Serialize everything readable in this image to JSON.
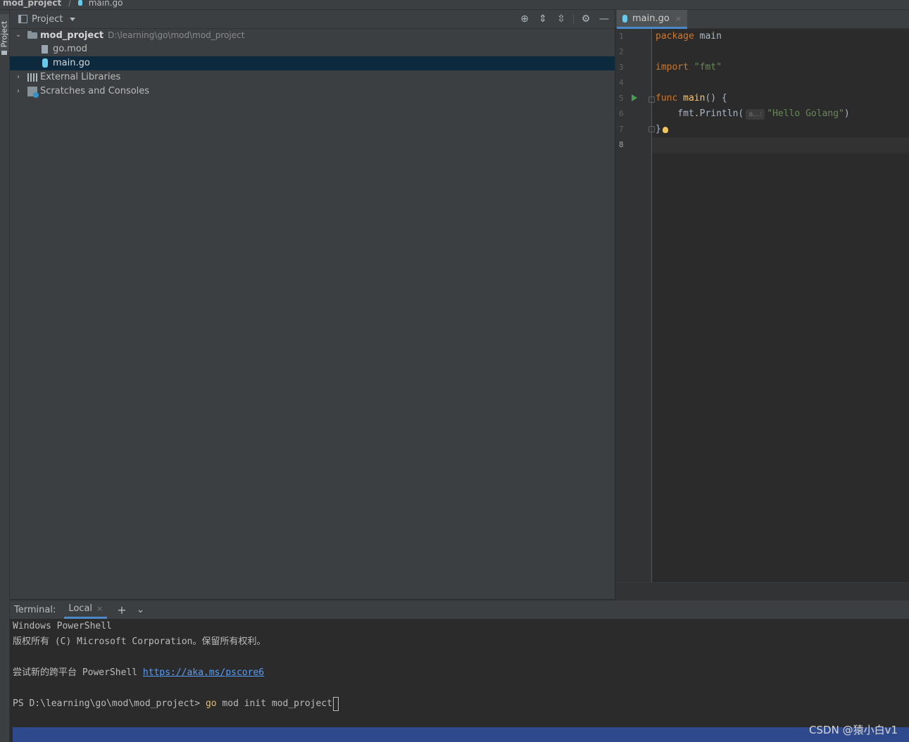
{
  "breadcrumb": {
    "project": "mod_project",
    "separator": "/",
    "file": "main.go"
  },
  "left_strip": {
    "tab_label": "Project"
  },
  "project_panel": {
    "title": "Project",
    "icons": [
      "locate-icon",
      "expand-all-icon",
      "collapse-all-icon",
      "gear-icon",
      "minimize-icon"
    ],
    "tree": {
      "root": {
        "name": "mod_project",
        "path": "D:\\learning\\go\\mod\\mod_project"
      },
      "files": [
        {
          "name": "go.mod",
          "icon": "file-icon"
        },
        {
          "name": "main.go",
          "icon": "go-file-icon",
          "selected": true
        }
      ],
      "external_libraries": "External Libraries",
      "scratches": "Scratches and Consoles"
    }
  },
  "editor": {
    "tab": {
      "label": "main.go",
      "close": "×"
    },
    "line_numbers": [
      "1",
      "2",
      "3",
      "4",
      "5",
      "6",
      "7",
      "8"
    ],
    "code": {
      "l1_kw": "package",
      "l1_rest": " main",
      "l3_kw": "import",
      "l3_str": "\"fmt\"",
      "l5_kw": "func",
      "l5_fn": "main",
      "l5_rest": "() {",
      "l6_pre": "    fmt.Println(",
      "l6_hint": "a...:",
      "l6_str": "\"Hello Golang\"",
      "l6_post": ")",
      "l7": "}"
    }
  },
  "terminal": {
    "title": "Terminal:",
    "tab": "Local",
    "tab_close": "×",
    "add": "+",
    "menu": "⌄",
    "lines": {
      "l1": "Windows PowerShell",
      "l2": "版权所有 (C) Microsoft Corporation。保留所有权利。",
      "l4_text": "尝试新的跨平台 PowerShell ",
      "l4_link": "https://aka.ms/pscore6",
      "l6_prompt": "PS D:\\learning\\go\\mod\\mod_project> ",
      "l6_cmd": "go",
      "l6_rest": " mod init mod_project"
    }
  },
  "watermark": "CSDN @猿小白v1",
  "colors": {
    "keyword": "#cc7832",
    "function": "#ffc66d",
    "string": "#6a8759",
    "selection": "#0d293e",
    "link": "#589df6",
    "status_bar": "#2f4a8c"
  }
}
